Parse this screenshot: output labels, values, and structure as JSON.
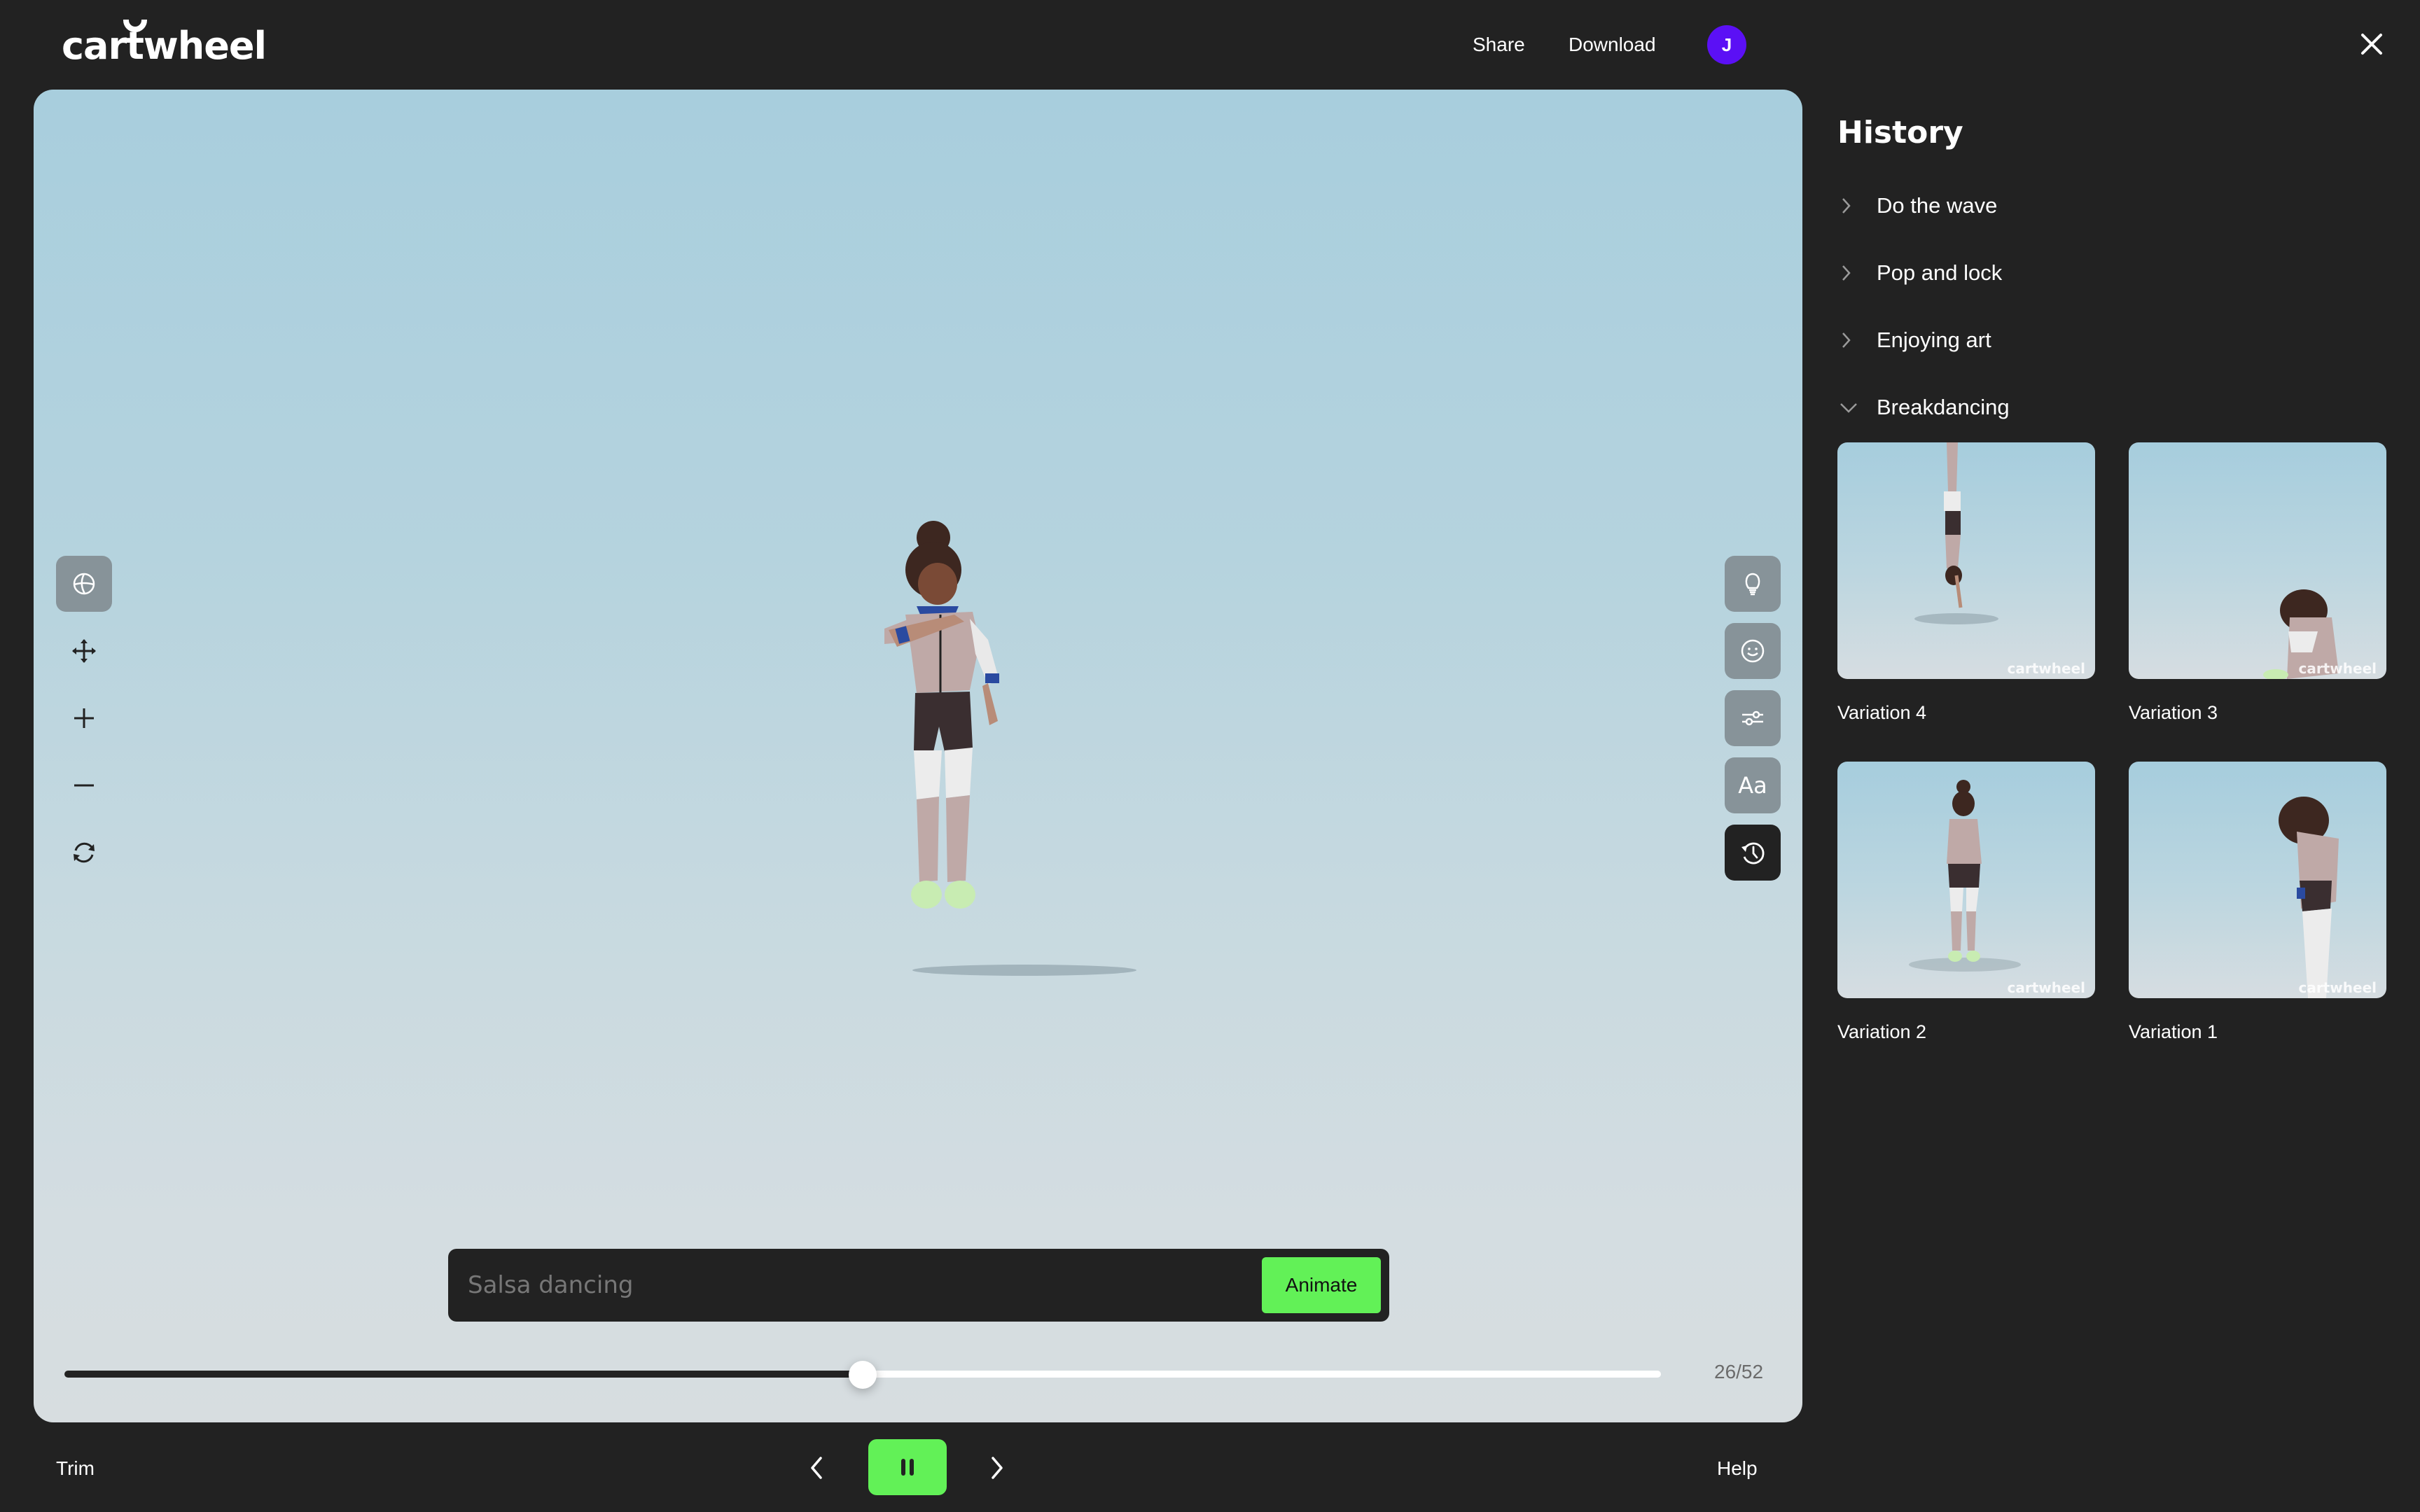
{
  "app": {
    "logo_text": "cartwheel"
  },
  "header": {
    "share_label": "Share",
    "download_label": "Download",
    "avatar_initial": "J",
    "avatar_color": "#5b10f5",
    "close_icon": "close-icon"
  },
  "left_tools": [
    {
      "name": "orbit",
      "icon": "globe-icon",
      "active": true
    },
    {
      "name": "pan",
      "icon": "move-icon",
      "active": false
    },
    {
      "name": "zoom-in",
      "icon": "plus-icon",
      "active": false
    },
    {
      "name": "zoom-out",
      "icon": "minus-icon",
      "active": false
    },
    {
      "name": "reset",
      "icon": "refresh-icon",
      "active": false
    }
  ],
  "right_tools": [
    {
      "name": "ideas",
      "icon": "lightbulb-icon",
      "active": false
    },
    {
      "name": "expression",
      "icon": "smiley-icon",
      "active": false
    },
    {
      "name": "adjust",
      "icon": "sliders-icon",
      "active": false
    },
    {
      "name": "text",
      "icon": "text-icon",
      "label": "Aa",
      "active": false
    },
    {
      "name": "history",
      "icon": "history-icon",
      "active": true
    }
  ],
  "prompt": {
    "placeholder": "Salsa dancing",
    "value": "",
    "animate_label": "Animate",
    "accent_color": "#62f157"
  },
  "timeline": {
    "current_frame": 26,
    "total_frames": 52,
    "readout": "26/52",
    "progress": 0.49
  },
  "bottom_bar": {
    "trim_label": "Trim",
    "help_label": "Help",
    "prev_icon": "chevron-left-icon",
    "play_state": "playing",
    "pause_icon": "pause-icon",
    "next_icon": "chevron-right-icon"
  },
  "history": {
    "title": "History",
    "items": [
      {
        "label": "Do the wave",
        "expanded": false
      },
      {
        "label": "Pop and lock",
        "expanded": false
      },
      {
        "label": "Enjoying art",
        "expanded": false
      },
      {
        "label": "Breakdancing",
        "expanded": true
      }
    ],
    "variations": [
      {
        "label": "Variation 4",
        "pose": "upside-down"
      },
      {
        "label": "Variation 3",
        "pose": "crouching"
      },
      {
        "label": "Variation 2",
        "pose": "standing"
      },
      {
        "label": "Variation 1",
        "pose": "bending"
      }
    ],
    "watermark": "cartwheel"
  }
}
